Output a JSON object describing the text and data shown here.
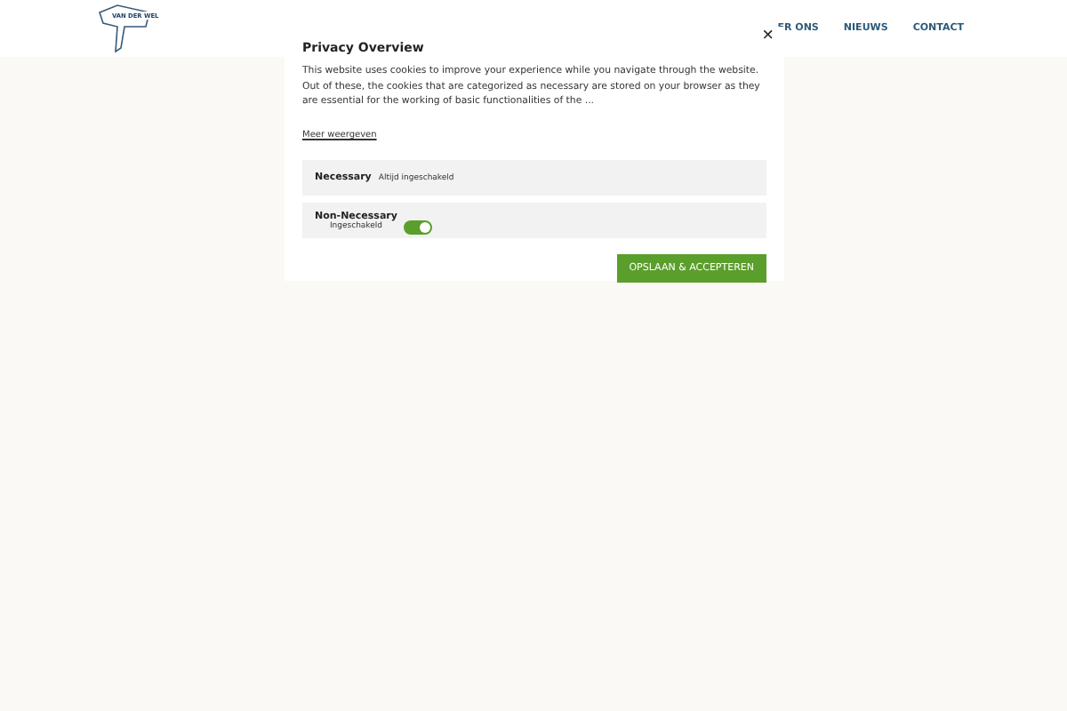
{
  "header": {
    "logo_text": "VAN DER WEL",
    "nav": [
      "ER ONS",
      "NIEUWS",
      "CONTACT"
    ]
  },
  "modal": {
    "close": "×",
    "title": "Privacy Overview",
    "body": "This website uses cookies to improve your experience while you navigate through the website. Out of these, the cookies that are categorized as necessary are stored on your browser as they are essential for the working of basic functionalities of the ...",
    "more_link": "Meer weergeven",
    "categories": [
      {
        "kind": "fixed",
        "name": "Necessary",
        "status": "Altijd ingeschakeld"
      },
      {
        "kind": "toggle",
        "name": "Non-Necessary",
        "status": "Ingeschakeld",
        "on": true
      }
    ],
    "save_button": "OPSLAAN & ACCEPTEREN"
  }
}
